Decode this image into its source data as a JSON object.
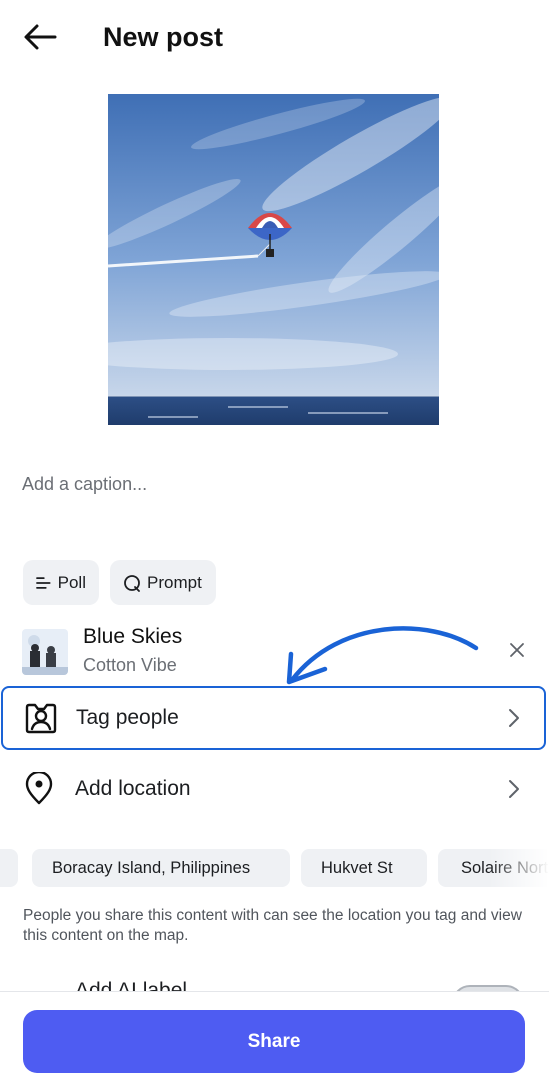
{
  "header": {
    "title": "New post",
    "back_icon": "arrow-left-icon"
  },
  "caption": {
    "placeholder": "Add a caption...",
    "value": ""
  },
  "chips": [
    {
      "label": "Poll",
      "icon": "poll-icon"
    },
    {
      "label": "Prompt",
      "icon": "prompt-icon"
    }
  ],
  "music": {
    "title": "Blue Skies",
    "artist": "Cotton Vibe",
    "close_icon": "close-icon"
  },
  "rows": {
    "tag_people": {
      "label": "Tag people",
      "icon": "person-tag-icon",
      "highlighted": true
    },
    "add_location": {
      "label": "Add location",
      "icon": "location-pin-icon"
    }
  },
  "location_suggestions": [
    "Boracay Island, Philippines",
    "Hukvet St",
    "Solaire North"
  ],
  "location_info": "People you share this content with can see the location you tag and view this content on the map.",
  "ai_label": {
    "label": "Add AI label",
    "enabled": false
  },
  "share_button": {
    "label": "Share"
  },
  "colors": {
    "accent": "#4e5cf2",
    "highlight": "#1a63d6",
    "chip_bg": "#eff1f4"
  }
}
